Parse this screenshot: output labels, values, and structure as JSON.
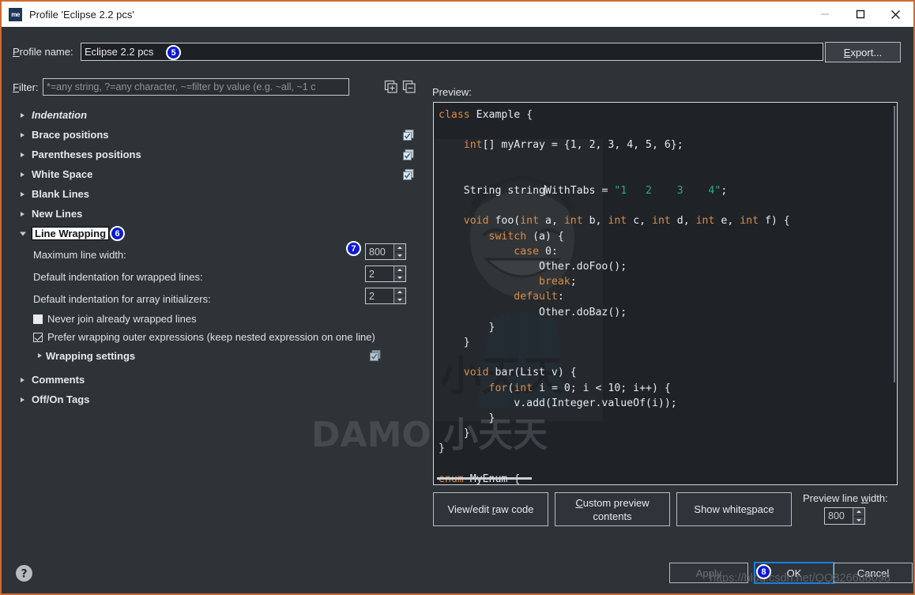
{
  "window": {
    "title": "Profile 'Eclipse 2.2 pcs'",
    "app_icon": "me",
    "minimize": "–",
    "maximize": "☐",
    "close": "✕"
  },
  "form": {
    "profile_name_label": "Profile name:",
    "profile_name_value": "Eclipse 2.2 pcs",
    "export_label": "Export...",
    "filter_label": "Filter:",
    "filter_value": "",
    "filter_placeholder": "*=any string, ?=any character, ~=filter by value (e.g. ~all, ~1 c",
    "expand_all_icon": "expand-all-icon",
    "collapse_all_icon": "collapse-all-icon",
    "preview_label": "Preview:"
  },
  "tree": {
    "items": [
      {
        "label": "Indentation",
        "expanded": false,
        "italic": true,
        "checkall": false
      },
      {
        "label": "Brace positions",
        "expanded": false,
        "italic": false,
        "checkall": true
      },
      {
        "label": "Parentheses positions",
        "expanded": false,
        "italic": false,
        "checkall": true
      },
      {
        "label": "White Space",
        "expanded": false,
        "italic": false,
        "checkall": true
      },
      {
        "label": "Blank Lines",
        "expanded": false,
        "italic": false,
        "checkall": false
      },
      {
        "label": "New Lines",
        "expanded": false,
        "italic": false,
        "checkall": false
      },
      {
        "label": "Line Wrapping",
        "expanded": true,
        "italic": false,
        "checkall": false,
        "selected": true
      }
    ],
    "trailing": [
      {
        "label": "Comments",
        "expanded": false
      },
      {
        "label": "Off/On Tags",
        "expanded": false
      }
    ]
  },
  "line_wrapping": {
    "fields": [
      {
        "label": "Maximum line width:",
        "value": "800"
      },
      {
        "label": "Default indentation for wrapped lines:",
        "value": "2"
      },
      {
        "label": "Default indentation for array initializers:",
        "value": "2"
      }
    ],
    "checkboxes": [
      {
        "label": "Never join already wrapped lines",
        "checked": false
      },
      {
        "label": "Prefer wrapping outer expressions (keep nested expression on one line)",
        "checked": true
      }
    ],
    "sub_node": {
      "label": "Wrapping settings",
      "expanded": false,
      "checkall": true
    }
  },
  "badges": [
    {
      "number": "5",
      "target": "profile-name-field"
    },
    {
      "number": "6",
      "target": "line-wrapping-node"
    },
    {
      "number": "7",
      "target": "maximum-line-width-spinner"
    },
    {
      "number": "8",
      "target": "ok-button"
    }
  ],
  "preview": {
    "code_lines": [
      {
        "tokens": [
          {
            "t": "class",
            "c": "kw"
          },
          {
            "t": " Example {",
            "c": ""
          }
        ]
      },
      {
        "tokens": []
      },
      {
        "tokens": [
          {
            "t": "    ",
            "c": ""
          },
          {
            "t": "int",
            "c": "kw"
          },
          {
            "t": "[] myArray = {1, 2, 3, 4, 5, 6};",
            "c": ""
          }
        ]
      },
      {
        "tokens": []
      },
      {
        "tokens": []
      },
      {
        "tokens": [
          {
            "t": "    String string",
            "c": ""
          },
          {
            "t": "|",
            "c": "caret"
          },
          {
            "t": "WithTabs = ",
            "c": ""
          },
          {
            "t": "\"1   2    3    4\"",
            "c": "str"
          },
          {
            "t": ";",
            "c": ""
          }
        ]
      },
      {
        "tokens": []
      },
      {
        "tokens": [
          {
            "t": "    ",
            "c": ""
          },
          {
            "t": "void",
            "c": "kw"
          },
          {
            "t": " foo(",
            "c": ""
          },
          {
            "t": "int",
            "c": "kw"
          },
          {
            "t": " a, ",
            "c": ""
          },
          {
            "t": "int",
            "c": "kw"
          },
          {
            "t": " b, ",
            "c": ""
          },
          {
            "t": "int",
            "c": "kw"
          },
          {
            "t": " c, ",
            "c": ""
          },
          {
            "t": "int",
            "c": "kw"
          },
          {
            "t": " d, ",
            "c": ""
          },
          {
            "t": "int",
            "c": "kw"
          },
          {
            "t": " e, ",
            "c": ""
          },
          {
            "t": "int",
            "c": "kw"
          },
          {
            "t": " f) {",
            "c": ""
          }
        ]
      },
      {
        "tokens": [
          {
            "t": "        ",
            "c": ""
          },
          {
            "t": "switch",
            "c": "kw"
          },
          {
            "t": " (a) {",
            "c": ""
          }
        ]
      },
      {
        "tokens": [
          {
            "t": "            ",
            "c": ""
          },
          {
            "t": "case",
            "c": "kw"
          },
          {
            "t": " 0:",
            "c": ""
          }
        ]
      },
      {
        "tokens": [
          {
            "t": "                Other.doFoo();",
            "c": ""
          }
        ]
      },
      {
        "tokens": [
          {
            "t": "                ",
            "c": ""
          },
          {
            "t": "break",
            "c": "kw"
          },
          {
            "t": ";",
            "c": ""
          }
        ]
      },
      {
        "tokens": [
          {
            "t": "            ",
            "c": ""
          },
          {
            "t": "default",
            "c": "kw"
          },
          {
            "t": ":",
            "c": ""
          }
        ]
      },
      {
        "tokens": [
          {
            "t": "                Other.doBaz();",
            "c": ""
          }
        ]
      },
      {
        "tokens": [
          {
            "t": "        }",
            "c": ""
          }
        ]
      },
      {
        "tokens": [
          {
            "t": "    }",
            "c": ""
          }
        ]
      },
      {
        "tokens": []
      },
      {
        "tokens": [
          {
            "t": "    ",
            "c": ""
          },
          {
            "t": "void",
            "c": "kw"
          },
          {
            "t": " bar(List v) {",
            "c": ""
          }
        ]
      },
      {
        "tokens": [
          {
            "t": "        ",
            "c": ""
          },
          {
            "t": "for",
            "c": "kw"
          },
          {
            "t": "(",
            "c": ""
          },
          {
            "t": "int",
            "c": "kw"
          },
          {
            "t": " i = 0; i < 10; i++) {",
            "c": ""
          }
        ]
      },
      {
        "tokens": [
          {
            "t": "            v.add(Integer.valueOf(i));",
            "c": ""
          }
        ]
      },
      {
        "tokens": [
          {
            "t": "        }",
            "c": ""
          }
        ]
      },
      {
        "tokens": [
          {
            "t": "    }",
            "c": ""
          }
        ]
      },
      {
        "tokens": [
          {
            "t": "}",
            "c": ""
          }
        ]
      },
      {
        "tokens": []
      },
      {
        "tokens": [
          {
            "t": "enum",
            "c": "kw"
          },
          {
            "t": " MyEnum {",
            "c": ""
          }
        ]
      }
    ]
  },
  "preview_toolbar": {
    "view_raw_label": "View/edit raw code",
    "custom_preview_label": "Custom preview contents",
    "show_whitespace_label": "Show whitespace",
    "preview_line_width_label": "Preview line width:",
    "preview_line_width_value": "800"
  },
  "footer": {
    "help_icon": "help-icon",
    "apply_label": "Apply",
    "ok_label": "OK",
    "cancel_label": "Cancel"
  },
  "watermark": {
    "url": "https://blog.csdn.net/QQ826688098",
    "brand": "DAMO 小天天"
  },
  "colors": {
    "accent_border": "#cf6a30",
    "badge_blue": "#0a1ad2",
    "focus_blue": "#1a7fe0",
    "keyword": "#d98c4a",
    "string": "#2aab7e",
    "dialog_bg": "#2e3338"
  }
}
